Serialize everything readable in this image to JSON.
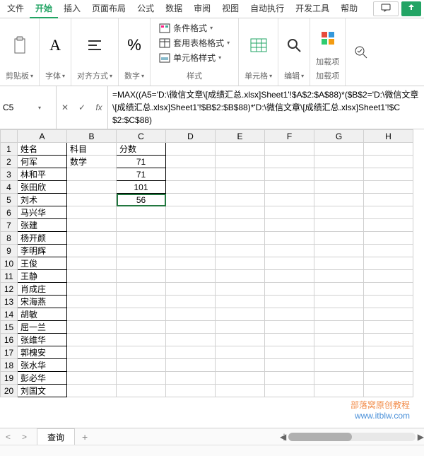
{
  "menu": {
    "items": [
      "文件",
      "开始",
      "插入",
      "页面布局",
      "公式",
      "数据",
      "审阅",
      "视图",
      "自动执行",
      "开发工具",
      "帮助"
    ],
    "active_index": 1
  },
  "ribbon": {
    "clipboard": "剪贴板",
    "font": "字体",
    "align": "对齐方式",
    "number": "数字",
    "cond_fmt": "条件格式",
    "table_fmt": "套用表格格式",
    "cell_fmt": "单元格样式",
    "style": "样式",
    "cells": "单元格",
    "edit": "编辑",
    "addin": "加载项",
    "addin_label": "加载项"
  },
  "namebox": "C5",
  "formula": "=MAX((A5='D:\\微信文章\\[成绩汇总.xlsx]Sheet1'!$A$2:$A$88)*($B$2='D:\\微信文章\\[成绩汇总.xlsx]Sheet1'!$B$2:$B$88)*'D:\\微信文章\\[成绩汇总.xlsx]Sheet1'!$C$2:$C$88)",
  "columns": [
    "A",
    "B",
    "C",
    "D",
    "E",
    "F",
    "G",
    "H"
  ],
  "rows": [
    {
      "n": 1,
      "A": "姓名",
      "B": "科目",
      "C": "分数",
      "cB": true
    },
    {
      "n": 2,
      "A": "何军",
      "B": "数学",
      "C": "71",
      "cB": true,
      "num": true
    },
    {
      "n": 3,
      "A": "林和平",
      "C": "71",
      "cB": true,
      "num": true
    },
    {
      "n": 4,
      "A": "张田欣",
      "C": "101",
      "cB": true,
      "num": true
    },
    {
      "n": 5,
      "A": "刘术",
      "C": "56",
      "cB": true,
      "num": true,
      "sel": true
    },
    {
      "n": 6,
      "A": "马兴华"
    },
    {
      "n": 7,
      "A": "张建"
    },
    {
      "n": 8,
      "A": "杨开颜"
    },
    {
      "n": 9,
      "A": "李明辉"
    },
    {
      "n": 10,
      "A": "王俊"
    },
    {
      "n": 11,
      "A": "王静"
    },
    {
      "n": 12,
      "A": "肖成庄"
    },
    {
      "n": 13,
      "A": "宋海燕"
    },
    {
      "n": 14,
      "A": "胡敏"
    },
    {
      "n": 15,
      "A": "屈一兰"
    },
    {
      "n": 16,
      "A": "张维华"
    },
    {
      "n": 17,
      "A": "郭槐安"
    },
    {
      "n": 18,
      "A": "张水华"
    },
    {
      "n": 19,
      "A": "彭必华"
    },
    {
      "n": 20,
      "A": "刘国文"
    }
  ],
  "sheet_tab": "查询",
  "watermark": {
    "l1": "部落窝原创教程",
    "l2": "www.itblw.com"
  }
}
